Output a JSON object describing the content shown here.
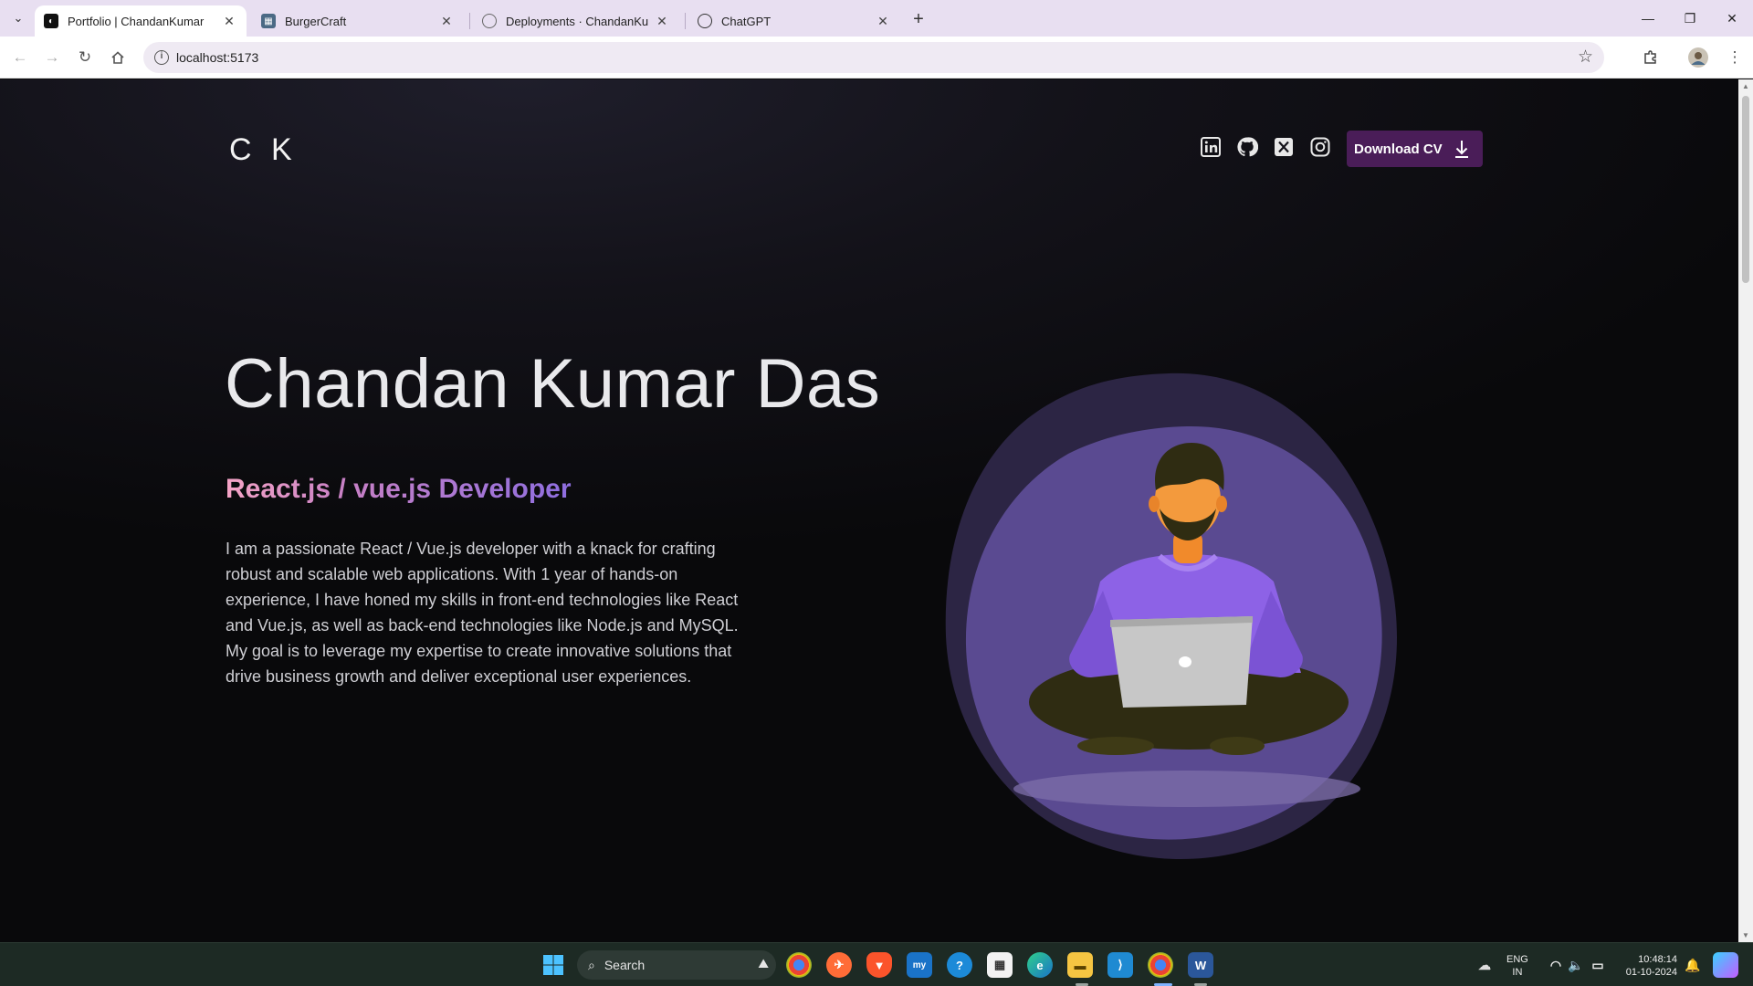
{
  "browser": {
    "tabs": [
      {
        "title": "Portfolio | ChandanKumar",
        "active": true
      },
      {
        "title": "BurgerCraft",
        "active": false
      },
      {
        "title": "Deployments · ChandanKumar",
        "active": false
      },
      {
        "title": "ChatGPT",
        "active": false
      }
    ],
    "url": "localhost:5173"
  },
  "page": {
    "logo": "C K",
    "socials": [
      "linkedin-icon",
      "github-icon",
      "x-icon",
      "instagram-icon"
    ],
    "cv_button": "Download CV",
    "name": "Chandan Kumar Das",
    "role": "React.js / vue.js Developer",
    "bio": "I am a passionate React / Vue.js developer with a knack for crafting robust and scalable web applications. With 1 year of hands-on experience, I have honed my skills in front-end technologies like React and Vue.js, as well as back-end technologies like Node.js and MySQL. My goal is to leverage my expertise to create innovative solutions that drive business growth and deliver exceptional user experiences.",
    "colors": {
      "accent_button": "#4a1d58",
      "role_gradient_start": "#f5a4c6",
      "role_gradient_end": "#8e6ee0",
      "blob_outer": "#2c2544",
      "blob_inner": "#5a4a91"
    }
  },
  "taskbar": {
    "search_placeholder": "Search",
    "language": "ENG",
    "region": "IN",
    "time": "10:48:14",
    "date": "01-10-2024"
  }
}
